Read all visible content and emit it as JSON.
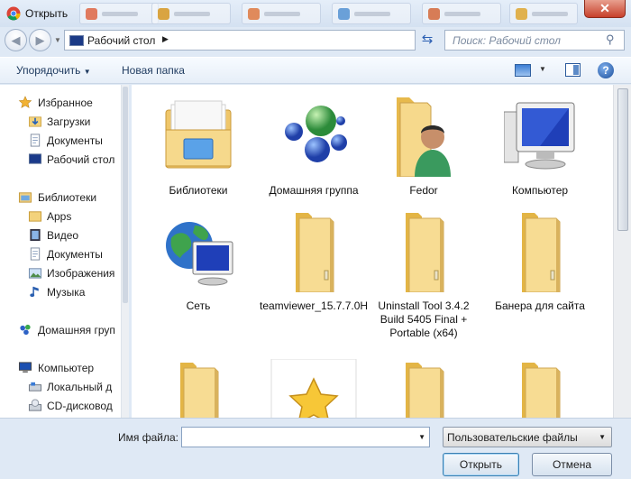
{
  "window": {
    "title": "Открыть",
    "close_label": "✕"
  },
  "nav": {
    "back_label": "◀",
    "forward_label": "▶",
    "address": "Рабочий стол",
    "search_placeholder": "Поиск: Рабочий стол"
  },
  "toolbar": {
    "organize": "Упорядочить",
    "new_folder": "Новая папка",
    "help": "?"
  },
  "sidebar": {
    "groups": [
      {
        "label": "Избранное",
        "icon": "star-icon",
        "items": [
          {
            "label": "Загрузки",
            "icon": "downloads-icon"
          },
          {
            "label": "Документы",
            "icon": "document-icon"
          },
          {
            "label": "Рабочий стол",
            "icon": "desktop-icon"
          }
        ]
      },
      {
        "label": "Библиотеки",
        "icon": "libraries-icon",
        "items": [
          {
            "label": "Apps",
            "icon": "folder-icon"
          },
          {
            "label": "Видео",
            "icon": "video-icon"
          },
          {
            "label": "Документы",
            "icon": "document-icon"
          },
          {
            "label": "Изображения",
            "icon": "image-icon"
          },
          {
            "label": "Музыка",
            "icon": "music-icon"
          }
        ]
      },
      {
        "label": "Домашняя груп",
        "icon": "homegroup-icon",
        "items": []
      },
      {
        "label": "Компьютер",
        "icon": "computer-icon",
        "items": [
          {
            "label": "Локальный д",
            "icon": "drive-icon"
          },
          {
            "label": "CD-дисковод",
            "icon": "cd-icon"
          }
        ]
      }
    ]
  },
  "files": [
    {
      "name": "Библиотеки",
      "icon": "libraries-icon"
    },
    {
      "name": "Домашняя группа",
      "icon": "homegroup-icon"
    },
    {
      "name": "Fedor",
      "icon": "user-folder-icon"
    },
    {
      "name": "Компьютер",
      "icon": "computer-icon"
    },
    {
      "name": "Сеть",
      "icon": "network-icon"
    },
    {
      "name": "teamviewer_15.7.7.0H",
      "icon": "folder-icon"
    },
    {
      "name": "Uninstall Tool 3.4.2 Build 5405 Final + Portable (x64)",
      "icon": "folder-icon"
    },
    {
      "name": "Банера для сайта",
      "icon": "folder-icon"
    },
    {
      "name": "",
      "icon": "folder-icon"
    },
    {
      "name": "",
      "icon": "star-shortcut-icon"
    },
    {
      "name": "",
      "icon": "folder-icon"
    },
    {
      "name": "",
      "icon": "folder-icon"
    }
  ],
  "footer": {
    "filename_label": "Имя файла:",
    "filename_value": "",
    "filetype": "Пользовательские файлы",
    "open": "Открыть",
    "cancel": "Отмена"
  }
}
